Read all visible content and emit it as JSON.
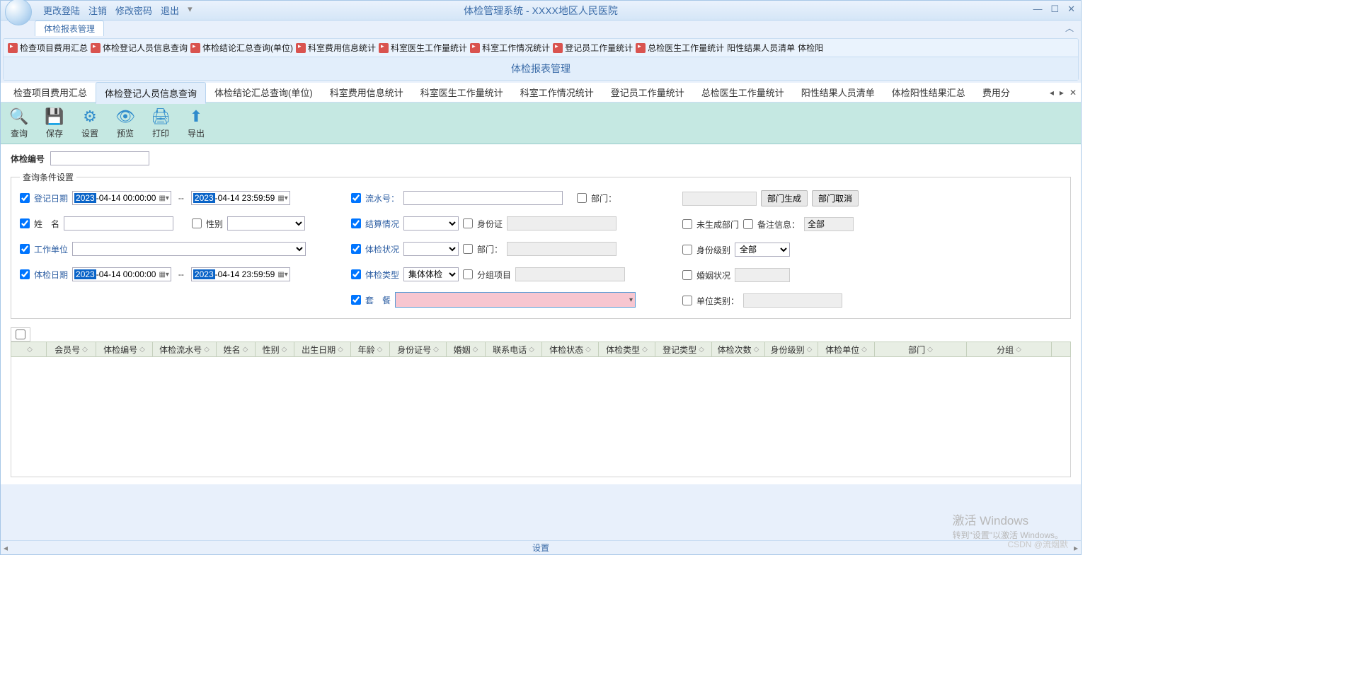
{
  "titlebar": {
    "menu": [
      "更改登陆",
      "注销",
      "修改密码",
      "退出"
    ],
    "title": "体检管理系统   -   XXXX地区人民医院"
  },
  "mainTab": "体检报表管理",
  "ribbon": {
    "items": [
      "检查项目费用汇总",
      "体检登记人员信息查询",
      "体检结论汇总查询(单位)",
      "科室费用信息统计",
      "科室医生工作量统计",
      "科室工作情况统计",
      "登记员工作量统计",
      "总检医生工作量统计",
      "阳性结果人员清单",
      "体检阳"
    ],
    "title": "体检报表管理"
  },
  "subtabs": {
    "items": [
      "检查项目费用汇总",
      "体检登记人员信息查询",
      "体检结论汇总查询(单位)",
      "科室费用信息统计",
      "科室医生工作量统计",
      "科室工作情况统计",
      "登记员工作量统计",
      "总检医生工作量统计",
      "阳性结果人员清单",
      "体检阳性结果汇总",
      "费用分"
    ],
    "activeIndex": 1
  },
  "toolbar": {
    "query": "查询",
    "save": "保存",
    "settings": "设置",
    "preview": "预览",
    "print": "打印",
    "export": "导出"
  },
  "form": {
    "codeLabel": "体检编号",
    "legend": "查询条件设置",
    "regDateLabel": "登记日期",
    "regFrom": {
      "y": "2023",
      "rest": "-04-14 00:00:00"
    },
    "regTo": {
      "y": "2023",
      "rest": "-04-14 23:59:59"
    },
    "nameLabel": "姓　名",
    "sexLabel": "性别",
    "unitLabel": "工作单位",
    "examDateLabel": "体检日期",
    "examFrom": {
      "y": "2023",
      "rest": "-04-14 00:00:00"
    },
    "examTo": {
      "y": "2023",
      "rest": "-04-14 23:59:59"
    },
    "flowLabel": "流水号：",
    "deptLabel": "部门：",
    "deptGen": "部门生成",
    "deptCancel": "部门取消",
    "settleLabel": "结算情况",
    "idLabel": "身份证",
    "noDeptLabel": "未生成部门",
    "remarkLabel": "备注信息：",
    "remarkVal": "全部",
    "examStatusLabel": "体检状况",
    "dept2Label": "部门：",
    "idLevelLabel": "身份级别",
    "idLevelVal": "全部",
    "examTypeLabel": "体检类型",
    "examTypeVal": "集体体检",
    "groupLabel": "分组项目",
    "marryLabel": "婚姻状况",
    "packageLabel": "套　餐",
    "unitTypeLabel": "单位类别："
  },
  "table": {
    "cols": [
      "",
      "会员号",
      "体检编号",
      "体检流水号",
      "姓名",
      "性别",
      "出生日期",
      "年龄",
      "身份证号",
      "婚姻",
      "联系电话",
      "体检状态",
      "体检类型",
      "登记类型",
      "体检次数",
      "身份级别",
      "体检单位",
      "部门",
      "分组"
    ]
  },
  "statusbar": "设置",
  "watermark": {
    "t1": "激活 Windows",
    "t2": "转到\"设置\"以激活 Windows。"
  },
  "csdn": "CSDN @流烟默"
}
